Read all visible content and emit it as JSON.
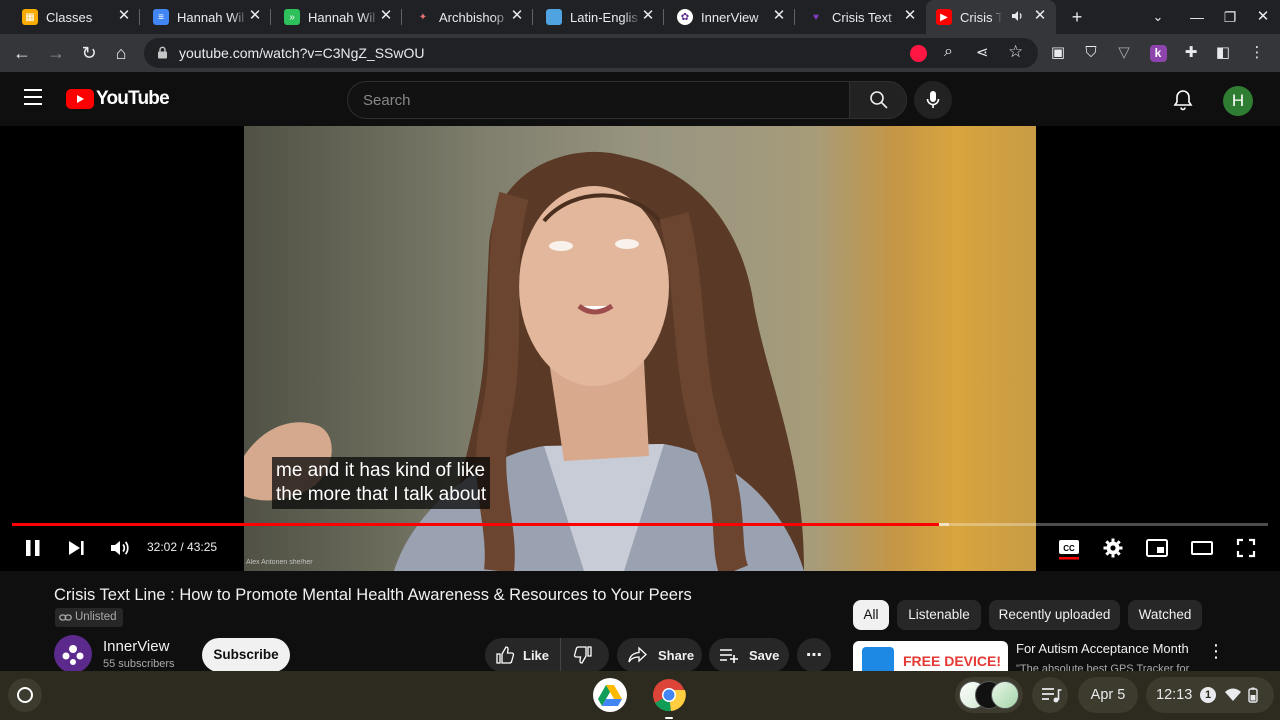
{
  "browser": {
    "tabs": [
      {
        "title": "Classes",
        "icon": "google-classroom-icon",
        "color": "#f9ab00"
      },
      {
        "title": "Hannah Wil",
        "icon": "google-docs-icon",
        "color": "#4285f4"
      },
      {
        "title": "Hannah Wil",
        "icon": "extension-doc-icon",
        "color": "#2ec05a"
      },
      {
        "title": "Archbishop",
        "icon": "archbishop-icon",
        "color": "#5c6bc0"
      },
      {
        "title": "Latin-Englis",
        "icon": "folder-icon",
        "color": "#4fa3e0"
      },
      {
        "title": "InnerView",
        "icon": "innerview-icon",
        "color": "#8e44ad"
      },
      {
        "title": "Crisis Text",
        "icon": "crisis-text-icon",
        "color": "#5b2a8c"
      },
      {
        "title": "Crisis T",
        "icon": "youtube-icon",
        "color": "#ff0000",
        "active": true
      }
    ],
    "url": "youtube.com/watch?v=C3NgZ_SSwOU"
  },
  "youtube": {
    "logo_text": "YouTube",
    "search_placeholder": "Search",
    "avatar_letter": "H"
  },
  "player": {
    "caption_line1": "me and it has kind of like",
    "caption_line2": "the more that I talk about",
    "speaker_tag": "Alex Antonen she/her",
    "time_current": "32:02",
    "time_total": "43:25",
    "progress": 0.7378,
    "buffered": 0.7463
  },
  "video_info": {
    "title": "Crisis Text Line : How to Promote Mental Health Awareness & Resources to Your Peers",
    "visibility": "Unlisted",
    "channel_name": "InnerView",
    "channel_subs": "55 subscribers",
    "subscribe_label": "Subscribe",
    "like_label": "Like",
    "share_label": "Share",
    "save_label": "Save"
  },
  "recommendations": {
    "chips": [
      "All",
      "Listenable",
      "Recently uploaded",
      "Watched"
    ],
    "first": {
      "thumb_text": "FREE DEVICE!",
      "title": "For Autism Acceptance Month",
      "subtitle": "\"The absolute best GPS Tracker for"
    }
  },
  "shelf": {
    "date": "Apr 5",
    "time": "12:13",
    "notification_count": "1"
  },
  "colors": {
    "accent_red": "#ff0000",
    "chrome_dark": "#202124",
    "toolbar": "#35363a",
    "yt_bg": "#0f0f0f"
  }
}
